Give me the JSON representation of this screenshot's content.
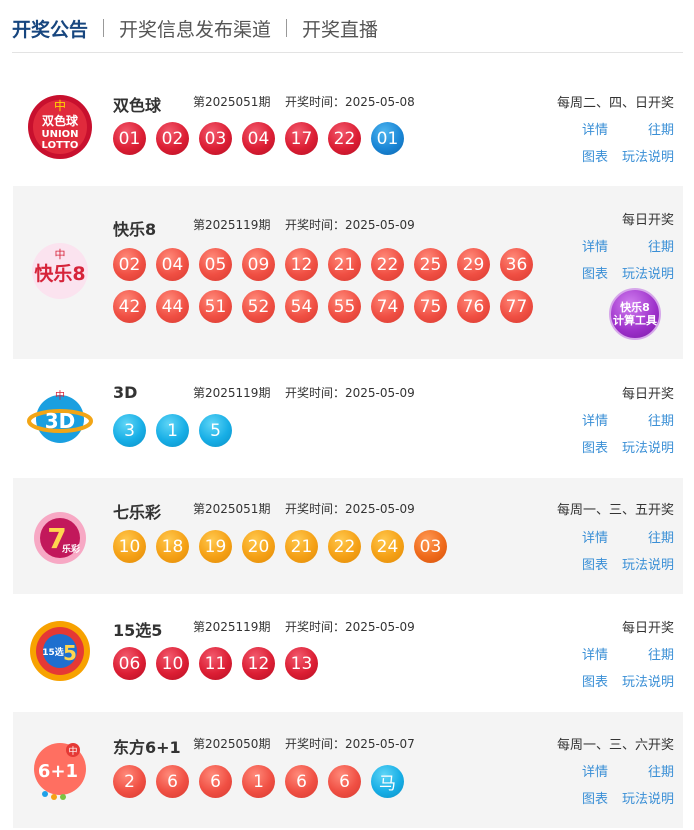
{
  "tabs": [
    {
      "label": "开奖公告",
      "active": true
    },
    {
      "label": "开奖信息发布渠道",
      "active": false
    },
    {
      "label": "开奖直播",
      "active": false
    }
  ],
  "links": {
    "detail": "详情",
    "past": "往期",
    "chart": "图表",
    "rules": "玩法说明"
  },
  "lotteries": [
    {
      "name": "双色球",
      "issue": "第2025051期",
      "draw_time": "开奖时间：2025-05-08",
      "schedule": "每周二、四、日开奖",
      "logo_text": [
        "双色球",
        "UNION",
        "LOTTO"
      ],
      "balls": [
        {
          "n": "01",
          "c": "red"
        },
        {
          "n": "02",
          "c": "red"
        },
        {
          "n": "03",
          "c": "red"
        },
        {
          "n": "04",
          "c": "red"
        },
        {
          "n": "17",
          "c": "red"
        },
        {
          "n": "22",
          "c": "red"
        },
        {
          "n": "01",
          "c": "blue"
        }
      ]
    },
    {
      "name": "快乐8",
      "issue": "第2025119期",
      "draw_time": "开奖时间：2025-05-09",
      "schedule": "每日开奖",
      "logo_text": [
        "快乐8"
      ],
      "tool": [
        "快乐8",
        "计算工具"
      ],
      "balls_row1": [
        "02",
        "04",
        "05",
        "09",
        "12",
        "21",
        "22",
        "25",
        "29",
        "36"
      ],
      "balls_row2": [
        "42",
        "44",
        "51",
        "52",
        "54",
        "55",
        "74",
        "75",
        "76",
        "77"
      ]
    },
    {
      "name": "3D",
      "issue": "第2025119期",
      "draw_time": "开奖时间：2025-05-09",
      "schedule": "每日开奖",
      "logo_text": [
        "3D"
      ],
      "balls": [
        {
          "n": "3",
          "c": "cyan"
        },
        {
          "n": "1",
          "c": "cyan"
        },
        {
          "n": "5",
          "c": "cyan"
        }
      ]
    },
    {
      "name": "七乐彩",
      "issue": "第2025051期",
      "draw_time": "开奖时间：2025-05-09",
      "schedule": "每周一、三、五开奖",
      "logo_text": [
        "7",
        "乐彩"
      ],
      "balls": [
        {
          "n": "10",
          "c": "orange"
        },
        {
          "n": "18",
          "c": "orange"
        },
        {
          "n": "19",
          "c": "orange"
        },
        {
          "n": "20",
          "c": "orange"
        },
        {
          "n": "21",
          "c": "orange"
        },
        {
          "n": "22",
          "c": "orange"
        },
        {
          "n": "24",
          "c": "orange"
        },
        {
          "n": "03",
          "c": "deep-orange"
        }
      ]
    },
    {
      "name": "15选5",
      "issue": "第2025119期",
      "draw_time": "开奖时间：2025-05-09",
      "schedule": "每日开奖",
      "logo_text": [
        "15选",
        "5"
      ],
      "balls": [
        {
          "n": "06",
          "c": "red"
        },
        {
          "n": "10",
          "c": "red"
        },
        {
          "n": "11",
          "c": "red"
        },
        {
          "n": "12",
          "c": "red"
        },
        {
          "n": "13",
          "c": "red"
        }
      ]
    },
    {
      "name": "东方6+1",
      "issue": "第2025050期",
      "draw_time": "开奖时间：2025-05-07",
      "schedule": "每周一、三、六开奖",
      "logo_text": [
        "6+1"
      ],
      "balls": [
        {
          "n": "2",
          "c": "salmon"
        },
        {
          "n": "6",
          "c": "salmon"
        },
        {
          "n": "6",
          "c": "salmon"
        },
        {
          "n": "1",
          "c": "salmon"
        },
        {
          "n": "6",
          "c": "salmon"
        },
        {
          "n": "6",
          "c": "salmon"
        },
        {
          "n": "马",
          "c": "cyan"
        }
      ]
    }
  ],
  "colors": {
    "tab_active": "#17467f",
    "link": "#3a8fd6",
    "card_gray": "#f4f4f4"
  }
}
